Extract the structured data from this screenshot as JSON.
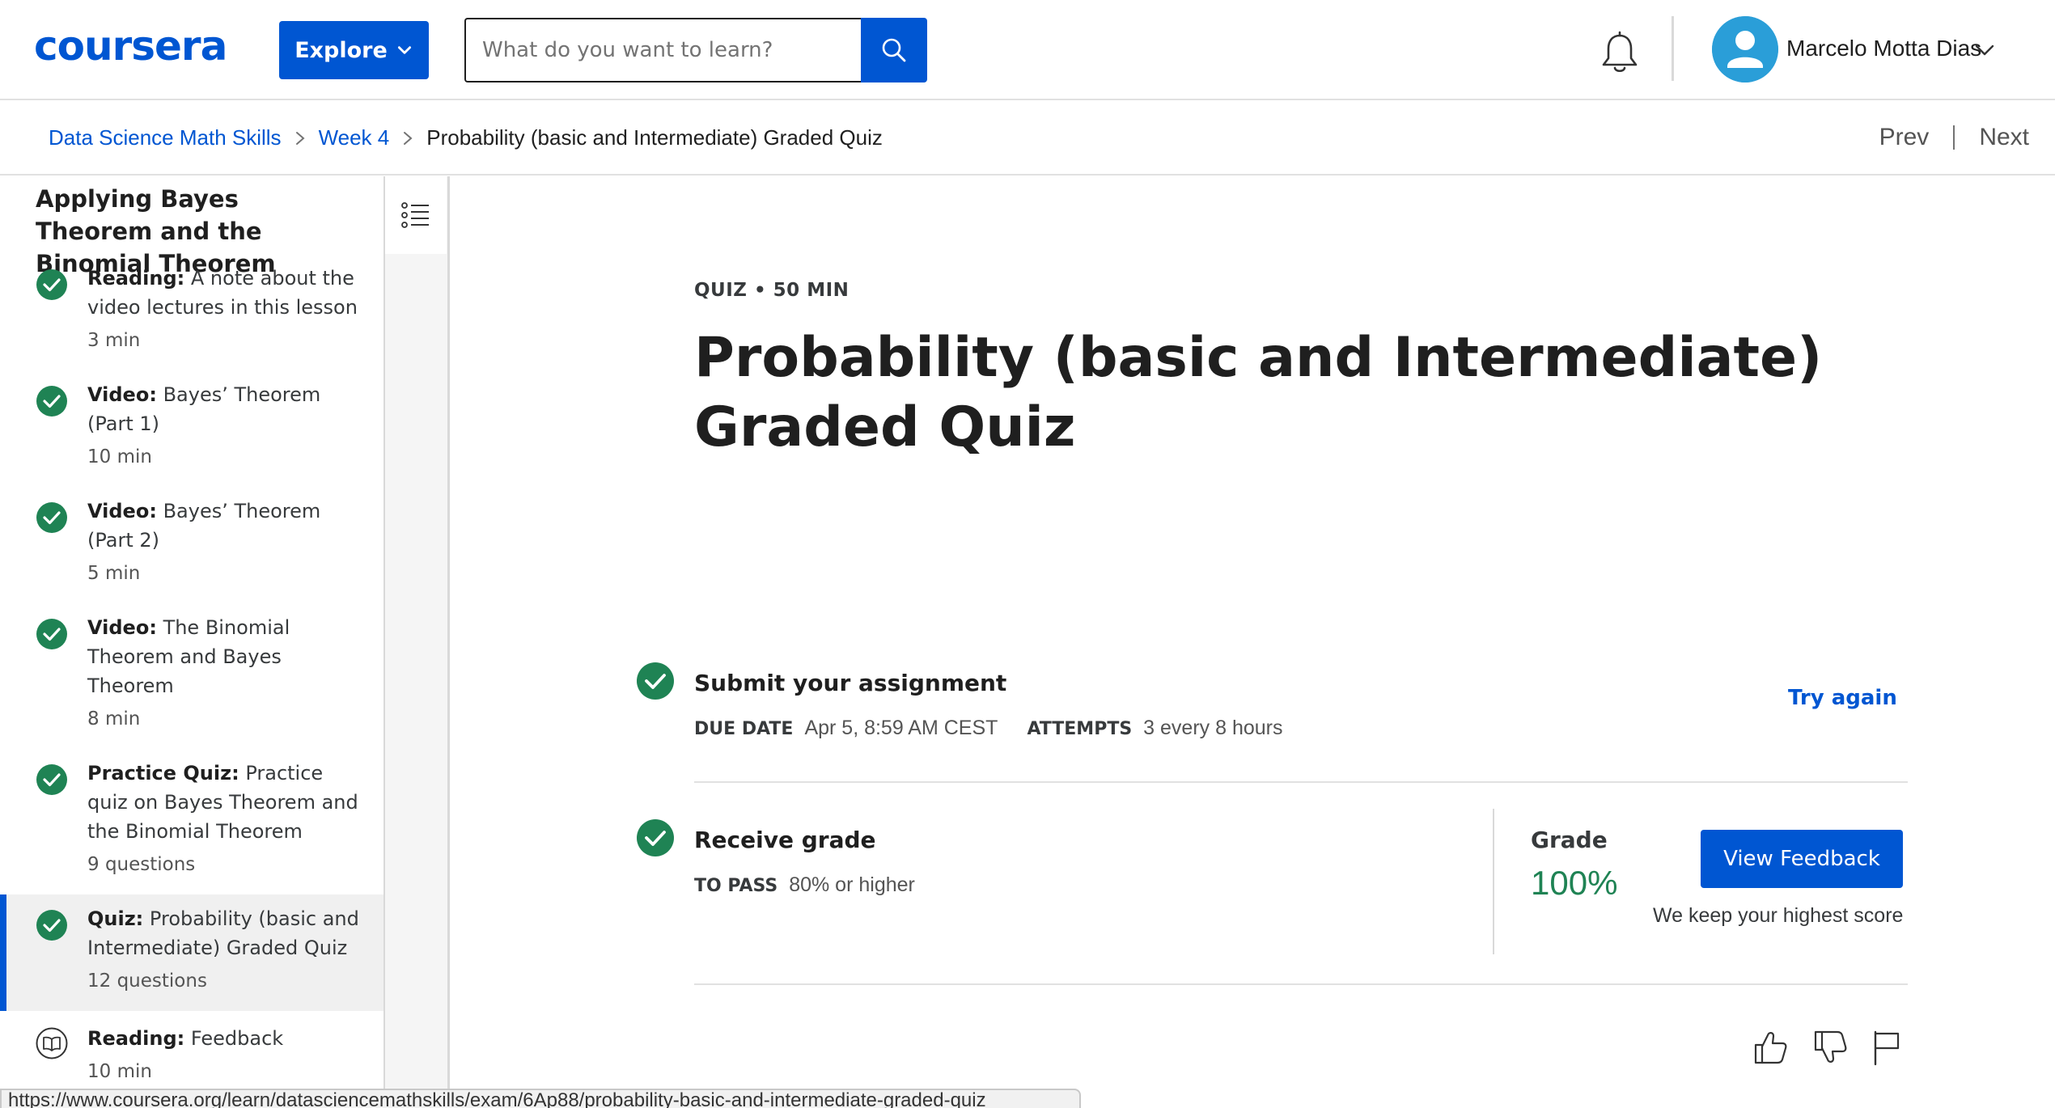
{
  "header": {
    "logo_text": "coursera",
    "explore_label": "Explore",
    "search_placeholder": "What do you want to learn?",
    "user_name": "Marcelo Motta Dias"
  },
  "breadcrumb": {
    "items": [
      "Data Science Math Skills",
      "Week 4"
    ],
    "current": "Probability (basic and Intermediate) Graded Quiz"
  },
  "nav": {
    "prev": "Prev",
    "next": "Next"
  },
  "sidebar": {
    "lesson_title": "Applying Bayes Theorem and the Binomial Theorem",
    "items": [
      {
        "type": "Reading:",
        "title": "A note about the video lectures in this lesson",
        "meta": "3 min",
        "completed": true
      },
      {
        "type": "Video:",
        "title": "Bayes’ Theorem (Part 1)",
        "meta": "10 min",
        "completed": true
      },
      {
        "type": "Video:",
        "title": "Bayes’ Theorem (Part 2)",
        "meta": "5 min",
        "completed": true
      },
      {
        "type": "Video:",
        "title": "The Binomial Theorem and Bayes Theorem",
        "meta": "8 min",
        "completed": true
      },
      {
        "type": "Practice Quiz:",
        "title": "Practice quiz on Bayes Theorem and the Binomial Theorem",
        "meta": "9 questions",
        "completed": true
      },
      {
        "type": "Quiz:",
        "title": "Probability (basic and Intermediate) Graded Quiz",
        "meta": "12 questions",
        "completed": true,
        "active": true
      },
      {
        "type": "Reading:",
        "title": "Feedback",
        "meta": "10 min",
        "completed": false
      }
    ]
  },
  "main": {
    "kicker": "QUIZ • 50 MIN",
    "title": "Probability (basic and Intermediate) Graded Quiz",
    "submit": {
      "title": "Submit your assignment",
      "due_label": "DUE DATE",
      "due_value": "Apr 5, 8:59 AM CEST",
      "attempts_label": "ATTEMPTS",
      "attempts_value": "3 every 8 hours",
      "try_again": "Try again"
    },
    "receive": {
      "title": "Receive grade",
      "pass_label": "TO PASS",
      "pass_value": "80% or higher",
      "grade_label": "Grade",
      "grade_value": "100%",
      "feedback_button": "View Feedback",
      "keep_note": "We keep your highest score"
    }
  },
  "status_url": "https://www.coursera.org/learn/datasciencemathskills/exam/6Ap88/probability-basic-and-intermediate-graded-quiz",
  "colors": {
    "brand": "#0056d2",
    "success": "#1f8354",
    "check": "#1f8354"
  },
  "icons": [
    "chevron-down-icon",
    "search-icon",
    "bell-icon",
    "user-avatar-icon",
    "chevron-right-icon",
    "check-circle-icon",
    "book-icon",
    "outline-list-icon",
    "thumbs-up-icon",
    "thumbs-down-icon",
    "flag-icon"
  ]
}
